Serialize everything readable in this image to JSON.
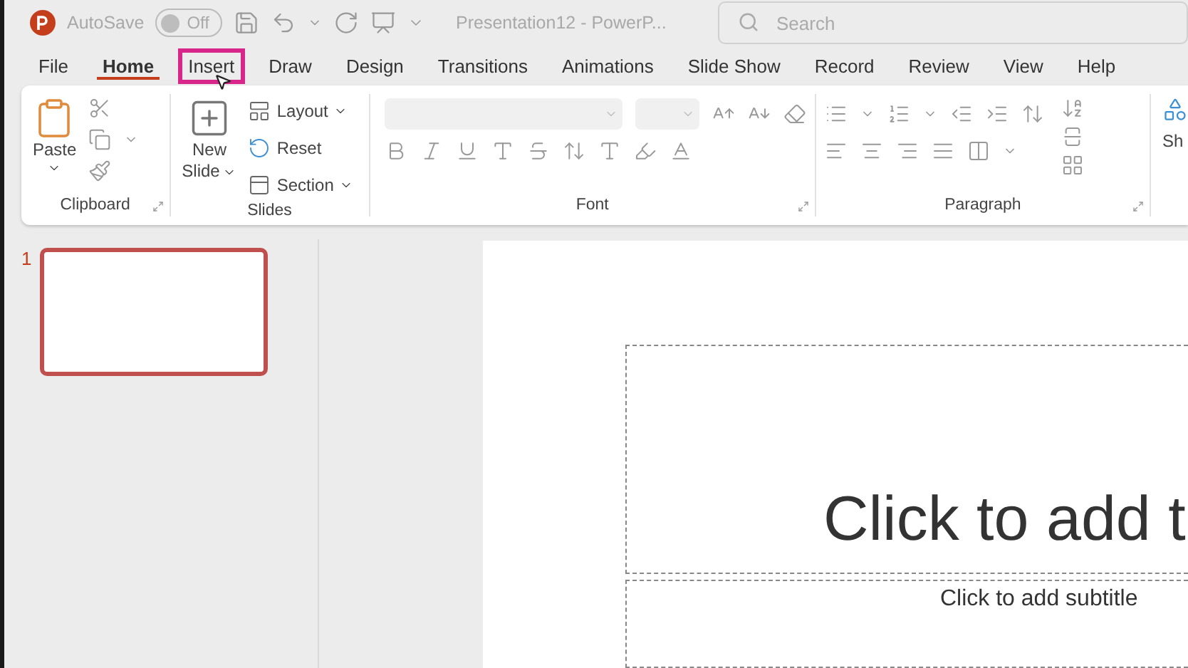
{
  "title_bar": {
    "autosave_label": "AutoSave",
    "autosave_toggle": {
      "label": "Off",
      "on": false
    },
    "document_title": "Presentation12  -  PowerP...",
    "search": {
      "placeholder": "Search"
    }
  },
  "tabs": [
    {
      "label": "File",
      "selected": false,
      "highlighted": false
    },
    {
      "label": "Home",
      "selected": true,
      "highlighted": false
    },
    {
      "label": "Insert",
      "selected": false,
      "highlighted": true
    },
    {
      "label": "Draw",
      "selected": false,
      "highlighted": false
    },
    {
      "label": "Design",
      "selected": false,
      "highlighted": false
    },
    {
      "label": "Transitions",
      "selected": false,
      "highlighted": false
    },
    {
      "label": "Animations",
      "selected": false,
      "highlighted": false
    },
    {
      "label": "Slide Show",
      "selected": false,
      "highlighted": false
    },
    {
      "label": "Record",
      "selected": false,
      "highlighted": false
    },
    {
      "label": "Review",
      "selected": false,
      "highlighted": false
    },
    {
      "label": "View",
      "selected": false,
      "highlighted": false
    },
    {
      "label": "Help",
      "selected": false,
      "highlighted": false
    }
  ],
  "ribbon": {
    "clipboard": {
      "title": "Clipboard",
      "paste": "Paste"
    },
    "slides": {
      "title": "Slides",
      "new_slide": [
        "New",
        "Slide"
      ],
      "layout": "Layout",
      "reset": "Reset",
      "section": "Section"
    },
    "font": {
      "title": "Font"
    },
    "paragraph": {
      "title": "Paragraph"
    },
    "shapes": {
      "label": "Sh"
    }
  },
  "thumbnails": [
    {
      "number": "1",
      "selected": true
    }
  ],
  "slide": {
    "title_placeholder": "Click to add t",
    "subtitle_placeholder": "Click to add subtitle"
  }
}
